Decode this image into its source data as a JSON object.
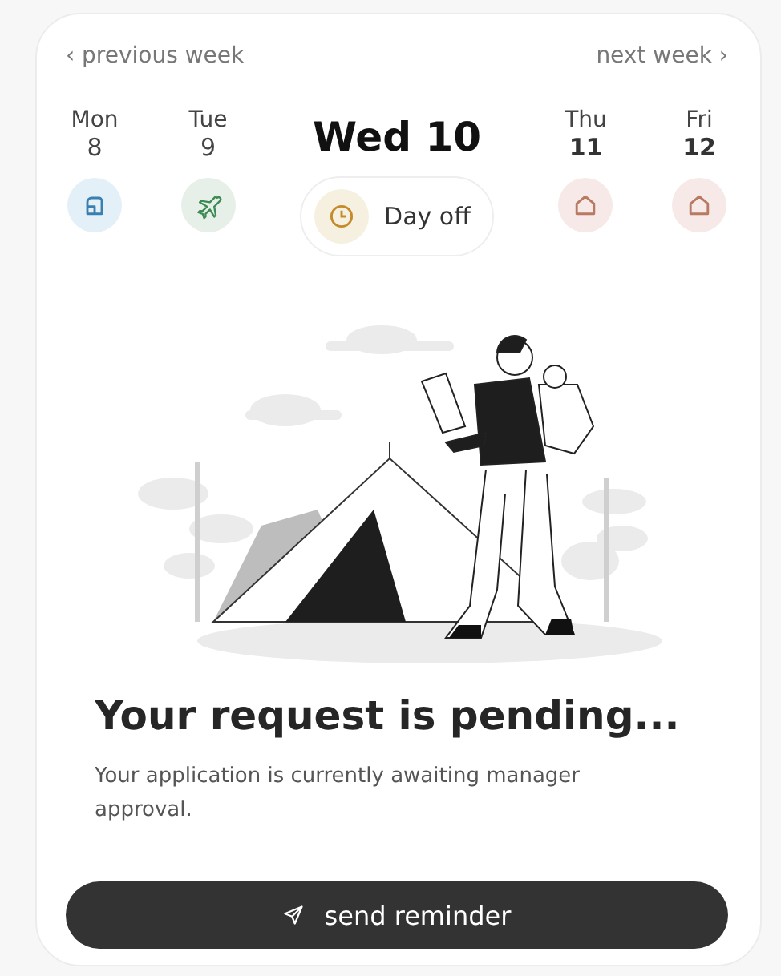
{
  "nav": {
    "previous": "‹ previous week",
    "next": "next week ›"
  },
  "days": [
    {
      "day": "Mon",
      "date": "8",
      "kind": "office",
      "selected": false
    },
    {
      "day": "Tue",
      "date": "9",
      "kind": "travel",
      "selected": false
    },
    {
      "day": "Wed",
      "date": "10",
      "kind": "time-off",
      "selected": true,
      "status": "Day off"
    },
    {
      "day": "Thu",
      "date": "11",
      "kind": "home",
      "selected": false
    },
    {
      "day": "Fri",
      "date": "12",
      "kind": "home",
      "selected": false
    }
  ],
  "message": {
    "title": "Your request is pending...",
    "body": "Your application is currently awaiting manager approval."
  },
  "button": {
    "label": "send reminder"
  }
}
